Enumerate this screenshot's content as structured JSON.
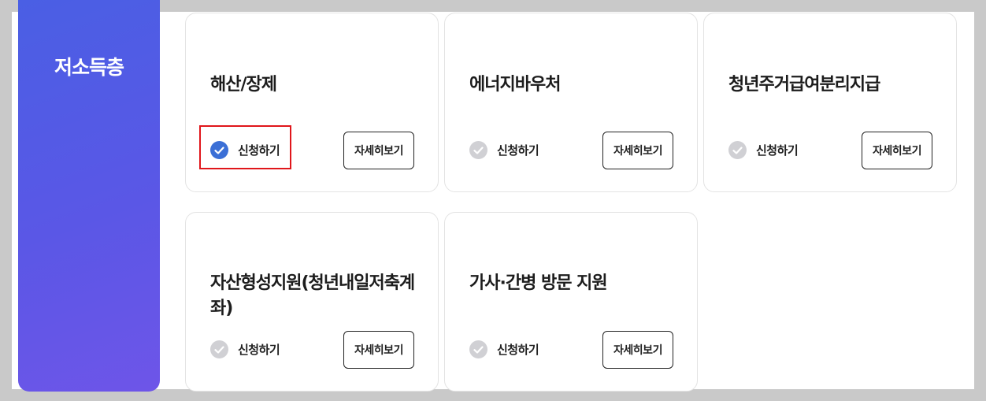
{
  "category": {
    "title": "저소득층"
  },
  "cards": [
    {
      "title": "해산/장제",
      "apply_label": "신청하기",
      "detail_label": "자세히보기",
      "apply_checked": true
    },
    {
      "title": "에너지바우처",
      "apply_label": "신청하기",
      "detail_label": "자세히보기",
      "apply_checked": false
    },
    {
      "title": "청년주거급여분리지급",
      "apply_label": "신청하기",
      "detail_label": "자세히보기",
      "apply_checked": false
    },
    {
      "title": "자산형성지원(청년내일저축계좌)",
      "apply_label": "신청하기",
      "detail_label": "자세히보기",
      "apply_checked": false
    },
    {
      "title": "가사·간병 방문 지원",
      "apply_label": "신청하기",
      "detail_label": "자세히보기",
      "apply_checked": false
    }
  ],
  "colors": {
    "category_gradient_start": "#4a5fe4",
    "category_gradient_end": "#6e55e8",
    "checked": "#3b6fd6",
    "unchecked": "#d0d0d4",
    "highlight": "#e0161b"
  }
}
